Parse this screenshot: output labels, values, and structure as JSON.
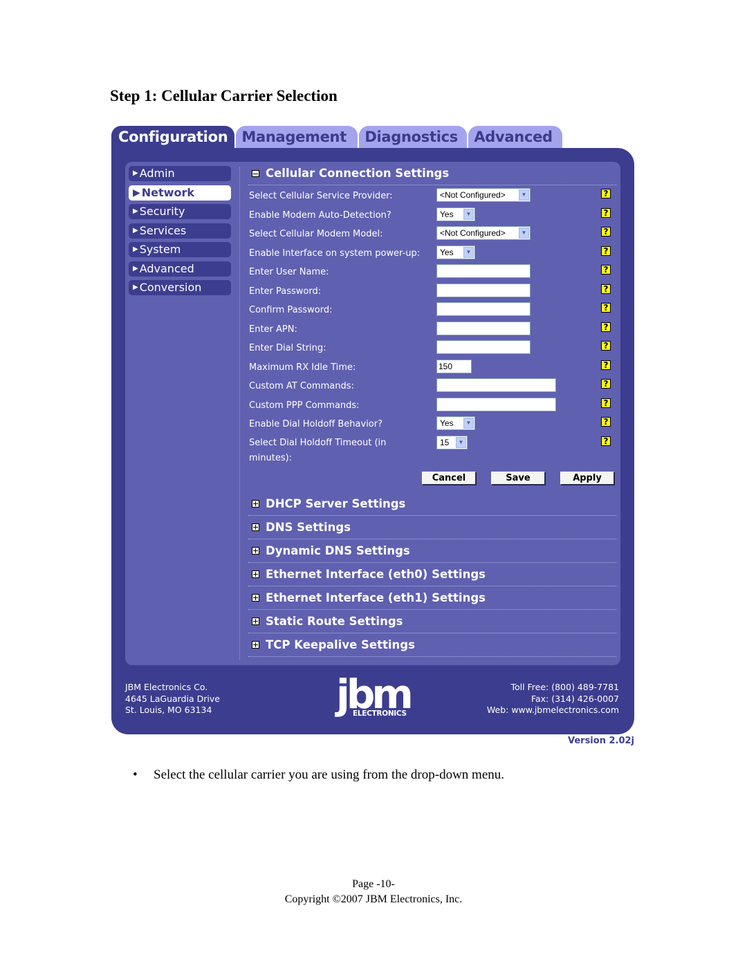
{
  "document": {
    "heading": "Step 1: Cellular Carrier Selection",
    "bullet": "Select the cellular carrier you are using from the drop-down menu.",
    "page_number": "Page -10-",
    "copyright": "Copyright ©2007 JBM Electronics, Inc."
  },
  "ui": {
    "tabs": [
      {
        "label": "Configuration",
        "active": true
      },
      {
        "label": "Management",
        "active": false
      },
      {
        "label": "Diagnostics",
        "active": false
      },
      {
        "label": "Advanced",
        "active": false
      }
    ],
    "sidebar": {
      "items": [
        {
          "label": "Admin",
          "active": false
        },
        {
          "label": "Network",
          "active": true
        },
        {
          "label": "Security",
          "active": false
        },
        {
          "label": "Services",
          "active": false
        },
        {
          "label": "System",
          "active": false
        },
        {
          "label": "Advanced",
          "active": false
        },
        {
          "label": "Conversion",
          "active": false
        }
      ]
    },
    "expanded_section": {
      "title": "Cellular Connection Settings",
      "icon": "minus-box-icon",
      "fields": [
        {
          "label": "Select Cellular Service Provider:",
          "type": "select",
          "value": "<Not Configured>"
        },
        {
          "label": "Enable Modem Auto-Detection?",
          "type": "select",
          "value": "Yes"
        },
        {
          "label": "Select Cellular Modem Model:",
          "type": "select",
          "value": "<Not Configured>"
        },
        {
          "label": "Enable Interface on system power-up:",
          "type": "select",
          "value": "Yes"
        },
        {
          "label": "Enter User Name:",
          "type": "text",
          "value": ""
        },
        {
          "label": "Enter Password:",
          "type": "password",
          "value": ""
        },
        {
          "label": "Confirm Password:",
          "type": "password",
          "value": ""
        },
        {
          "label": "Enter APN:",
          "type": "text",
          "value": ""
        },
        {
          "label": "Enter Dial String:",
          "type": "text",
          "value": ""
        },
        {
          "label": "Maximum RX Idle Time:",
          "type": "text",
          "value": "150"
        },
        {
          "label": "Custom AT Commands:",
          "type": "text",
          "value": ""
        },
        {
          "label": "Custom PPP Commands:",
          "type": "text",
          "value": ""
        },
        {
          "label": "Enable Dial Holdoff Behavior?",
          "type": "select",
          "value": "Yes"
        },
        {
          "label": "Select Dial Holdoff Timeout (in minutes):",
          "type": "select",
          "value": "15"
        }
      ],
      "help_icon": "?",
      "buttons": {
        "cancel": "Cancel",
        "save": "Save",
        "apply": "Apply"
      }
    },
    "collapsed_sections": [
      {
        "title": "DHCP Server Settings"
      },
      {
        "title": "DNS Settings"
      },
      {
        "title": "Dynamic DNS Settings"
      },
      {
        "title": "Ethernet Interface (eth0) Settings"
      },
      {
        "title": "Ethernet Interface (eth1) Settings"
      },
      {
        "title": "Static Route Settings"
      },
      {
        "title": "TCP Keepalive Settings"
      }
    ],
    "footer": {
      "company": "JBM Electronics Co.",
      "address": "4645 LaGuardia Drive",
      "city": "St. Louis, MO 63134",
      "toll_free": "Toll Free: (800) 489-7781",
      "fax": "Fax: (314) 426-0007",
      "web": "Web: www.jbmelectronics.com",
      "logo_text": "jbm",
      "logo_subtext": "ELECTRONICS"
    },
    "version": "Version 2.02j",
    "colors": {
      "frame": "#3d3d8f",
      "panel": "#6060b0",
      "inactive_tab": "#a4a4ee",
      "help_icon": "#ffff00"
    }
  }
}
